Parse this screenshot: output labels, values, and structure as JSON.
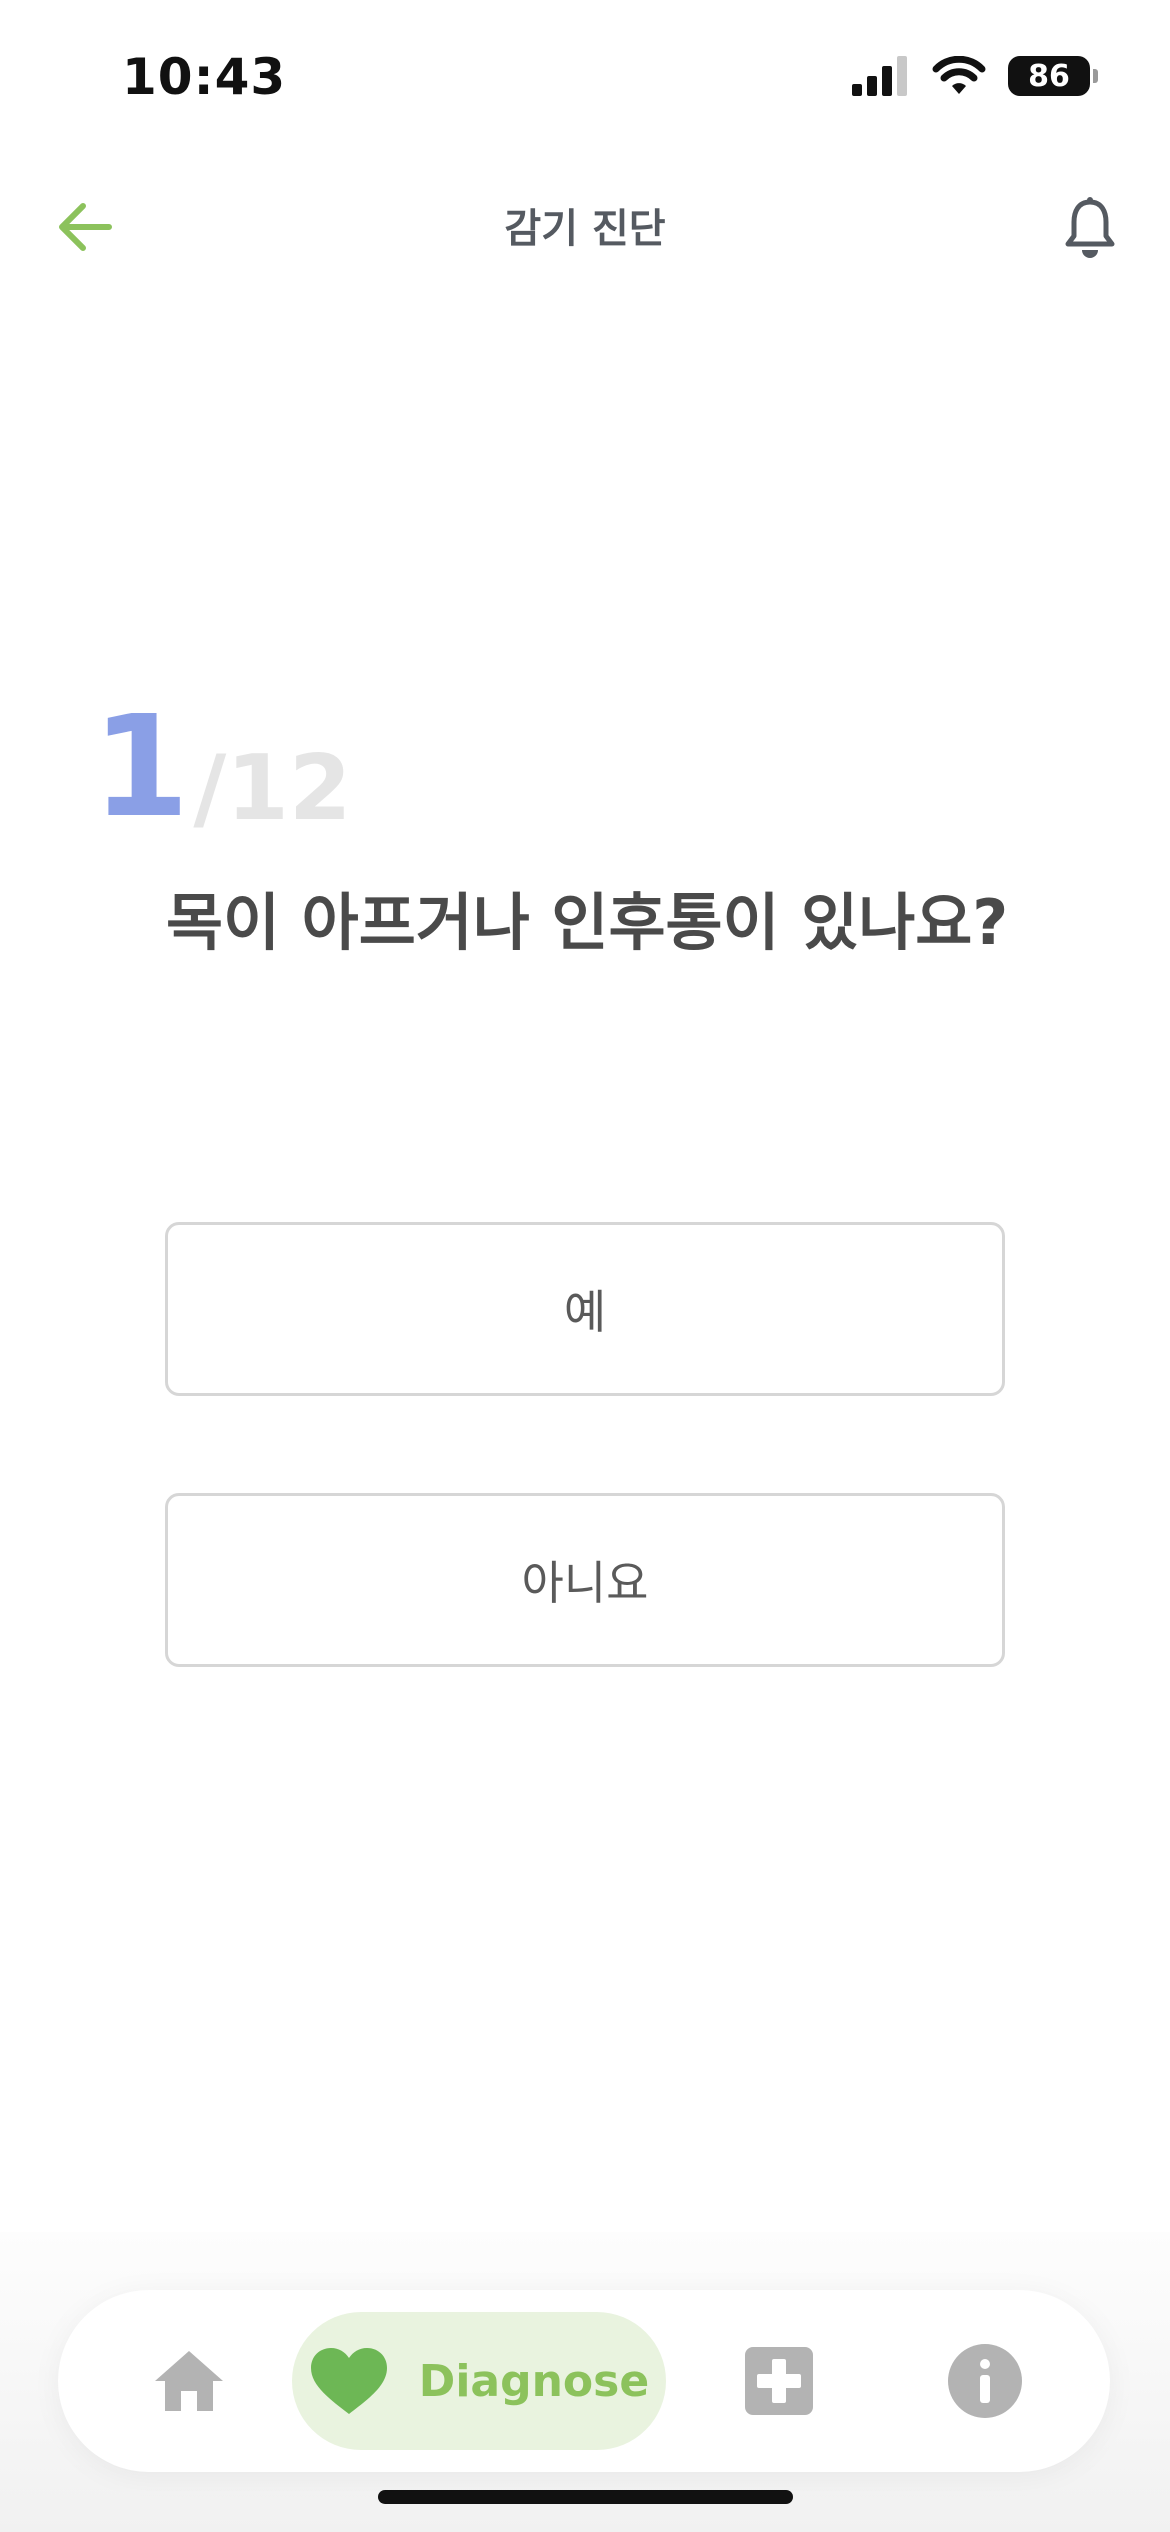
{
  "status_bar": {
    "time": "10:43",
    "battery": "86"
  },
  "header": {
    "title": "감기 진단",
    "back_icon": "arrow-left-icon",
    "notification_icon": "bell-icon"
  },
  "quiz": {
    "current": "1",
    "total": "/12",
    "question": "목이 아프거나 인후통이 있나요?",
    "answers": {
      "yes": "예",
      "no": "아니요"
    }
  },
  "bottom_nav": {
    "items": [
      {
        "icon": "home-icon",
        "active": false
      },
      {
        "icon": "heart-icon",
        "label": "Diagnose",
        "active": true
      },
      {
        "icon": "plus-square-icon",
        "active": false
      },
      {
        "icon": "info-icon",
        "active": false
      }
    ]
  },
  "colors": {
    "accent_green": "#8cc25c",
    "heart_green": "#6db755",
    "progress_blue": "#8a9fe6",
    "inactive_icon": "#b3b3b3"
  }
}
